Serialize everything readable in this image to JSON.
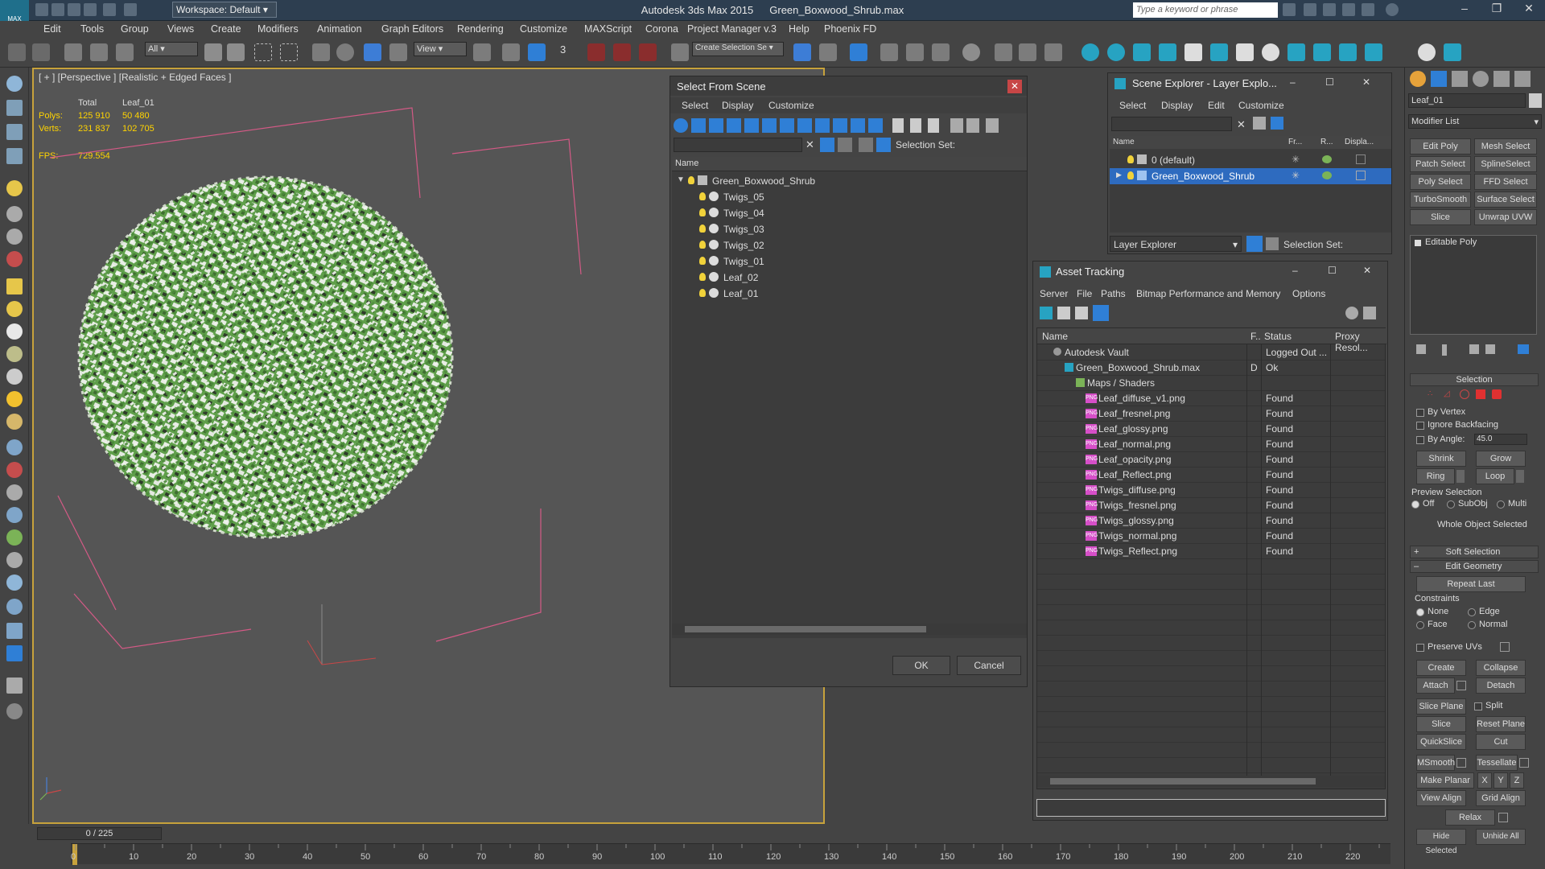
{
  "app": {
    "title": "Autodesk 3ds Max  2015",
    "filename": "Green_Boxwood_Shrub.max",
    "logo": "MAX",
    "workspace": "Workspace: Default",
    "search_placeholder": "Type a keyword or phrase"
  },
  "menu": [
    "Edit",
    "Tools",
    "Group",
    "Views",
    "Create",
    "Modifiers",
    "Animation",
    "Graph Editors",
    "Rendering",
    "Customize",
    "MAXScript",
    "Corona",
    "Project Manager v.3",
    "Help",
    "Phoenix FD"
  ],
  "toolbar": {
    "selection_filter": "All",
    "reference_coord": "View",
    "named_selection": "Create Selection Se",
    "snap_label": "3"
  },
  "viewport": {
    "label": "[ + ] [Perspective ] [Realistic + Edged Faces ]",
    "stats": {
      "total_label": "Total",
      "object_label": "Leaf_01",
      "polys_label": "Polys:",
      "verts_label": "Verts:",
      "polys_total": "125 910",
      "polys_obj": "50 480",
      "verts_total": "231 837",
      "verts_obj": "102 705",
      "fps_label": "FPS:",
      "fps": "729.554"
    }
  },
  "timeline": {
    "frame": "0 / 225",
    "ticks": [
      "0",
      "10",
      "20",
      "30",
      "40",
      "50",
      "60",
      "70",
      "80",
      "90",
      "100",
      "110",
      "120",
      "130",
      "140",
      "150",
      "160",
      "170",
      "180",
      "190",
      "200",
      "210",
      "220"
    ]
  },
  "select_from_scene": {
    "title": "Select From Scene",
    "menu": [
      "Select",
      "Display",
      "Customize"
    ],
    "selection_set_label": "Selection Set:",
    "column_name": "Name",
    "root": "Green_Boxwood_Shrub",
    "items": [
      "Twigs_05",
      "Twigs_04",
      "Twigs_03",
      "Twigs_02",
      "Twigs_01",
      "Leaf_02",
      "Leaf_01"
    ],
    "ok": "OK",
    "cancel": "Cancel"
  },
  "scene_explorer": {
    "title": "Scene Explorer - Layer Explo...",
    "menu": [
      "Select",
      "Display",
      "Edit",
      "Customize"
    ],
    "columns": [
      "Name",
      "Fr...",
      "R...",
      "Displa..."
    ],
    "layers": [
      "0 (default)",
      "Green_Boxwood_Shrub"
    ],
    "footer_dropdown": "Layer Explorer",
    "selection_set_label": "Selection Set:"
  },
  "asset_tracking": {
    "title": "Asset Tracking",
    "menu": [
      "Server",
      "File",
      "Paths",
      "Bitmap Performance and Memory",
      "Options"
    ],
    "columns": [
      "Name",
      "F..",
      "Status",
      "Proxy Resol..."
    ],
    "rows": [
      {
        "name": "Autodesk Vault",
        "flag": "",
        "status": "Logged Out ...",
        "type": "vault"
      },
      {
        "name": "Green_Boxwood_Shrub.max",
        "flag": "D",
        "status": "Ok",
        "type": "max"
      },
      {
        "name": "Maps / Shaders",
        "flag": "",
        "status": "",
        "type": "folder"
      },
      {
        "name": "Leaf_diffuse_v1.png",
        "flag": "",
        "status": "Found",
        "type": "png"
      },
      {
        "name": "Leaf_fresnel.png",
        "flag": "",
        "status": "Found",
        "type": "png"
      },
      {
        "name": "Leaf_glossy.png",
        "flag": "",
        "status": "Found",
        "type": "png"
      },
      {
        "name": "Leaf_normal.png",
        "flag": "",
        "status": "Found",
        "type": "png"
      },
      {
        "name": "Leaf_opacity.png",
        "flag": "",
        "status": "Found",
        "type": "png"
      },
      {
        "name": "Leaf_Reflect.png",
        "flag": "",
        "status": "Found",
        "type": "png"
      },
      {
        "name": "Twigs_diffuse.png",
        "flag": "",
        "status": "Found",
        "type": "png"
      },
      {
        "name": "Twigs_fresnel.png",
        "flag": "",
        "status": "Found",
        "type": "png"
      },
      {
        "name": "Twigs_glossy.png",
        "flag": "",
        "status": "Found",
        "type": "png"
      },
      {
        "name": "Twigs_normal.png",
        "flag": "",
        "status": "Found",
        "type": "png"
      },
      {
        "name": "Twigs_Reflect.png",
        "flag": "",
        "status": "Found",
        "type": "png"
      }
    ]
  },
  "command_panel": {
    "object_name": "Leaf_01",
    "modifier_list": "Modifier List",
    "modifier_buttons": [
      "Edit Poly",
      "Mesh Select",
      "Patch Select",
      "SplineSelect",
      "Poly Select",
      "FFD Select",
      "TurboSmooth",
      "Surface Select",
      "Slice",
      "Unwrap UVW"
    ],
    "stack_item": "Editable Poly",
    "selection_rollout": "Selection",
    "by_vertex": "By Vertex",
    "ignore_backfacing": "Ignore Backfacing",
    "by_angle": "By Angle:",
    "angle_value": "45.0",
    "shrink": "Shrink",
    "grow": "Grow",
    "ring": "Ring",
    "loop": "Loop",
    "preview_selection": "Preview Selection",
    "off": "Off",
    "subobj": "SubObj",
    "multi": "Multi",
    "whole_object": "Whole Object Selected",
    "soft_selection": "Soft Selection",
    "edit_geometry": "Edit Geometry",
    "repeat_last": "Repeat Last",
    "constraints": "Constraints",
    "none": "None",
    "edge": "Edge",
    "face": "Face",
    "normal": "Normal",
    "preserve_uvs": "Preserve UVs",
    "create": "Create",
    "collapse": "Collapse",
    "attach": "Attach",
    "detach": "Detach",
    "slice_plane": "Slice Plane",
    "split": "Split",
    "slice": "Slice",
    "reset_plane": "Reset Plane",
    "quickslice": "QuickSlice",
    "cut": "Cut",
    "msmooth": "MSmooth",
    "tessellate": "Tessellate",
    "make_planar": "Make Planar",
    "x": "X",
    "y": "Y",
    "z": "Z",
    "view_align": "View Align",
    "grid_align": "Grid Align",
    "relax": "Relax",
    "hide_selected": "Hide Selected",
    "unhide_all": "Unhide All"
  },
  "colors": {
    "accent_blue": "#2e6bbf",
    "viewport_border": "#c7a23c",
    "shrub_green": "#5f9f4a",
    "bbox_pink": "#d45a86"
  }
}
